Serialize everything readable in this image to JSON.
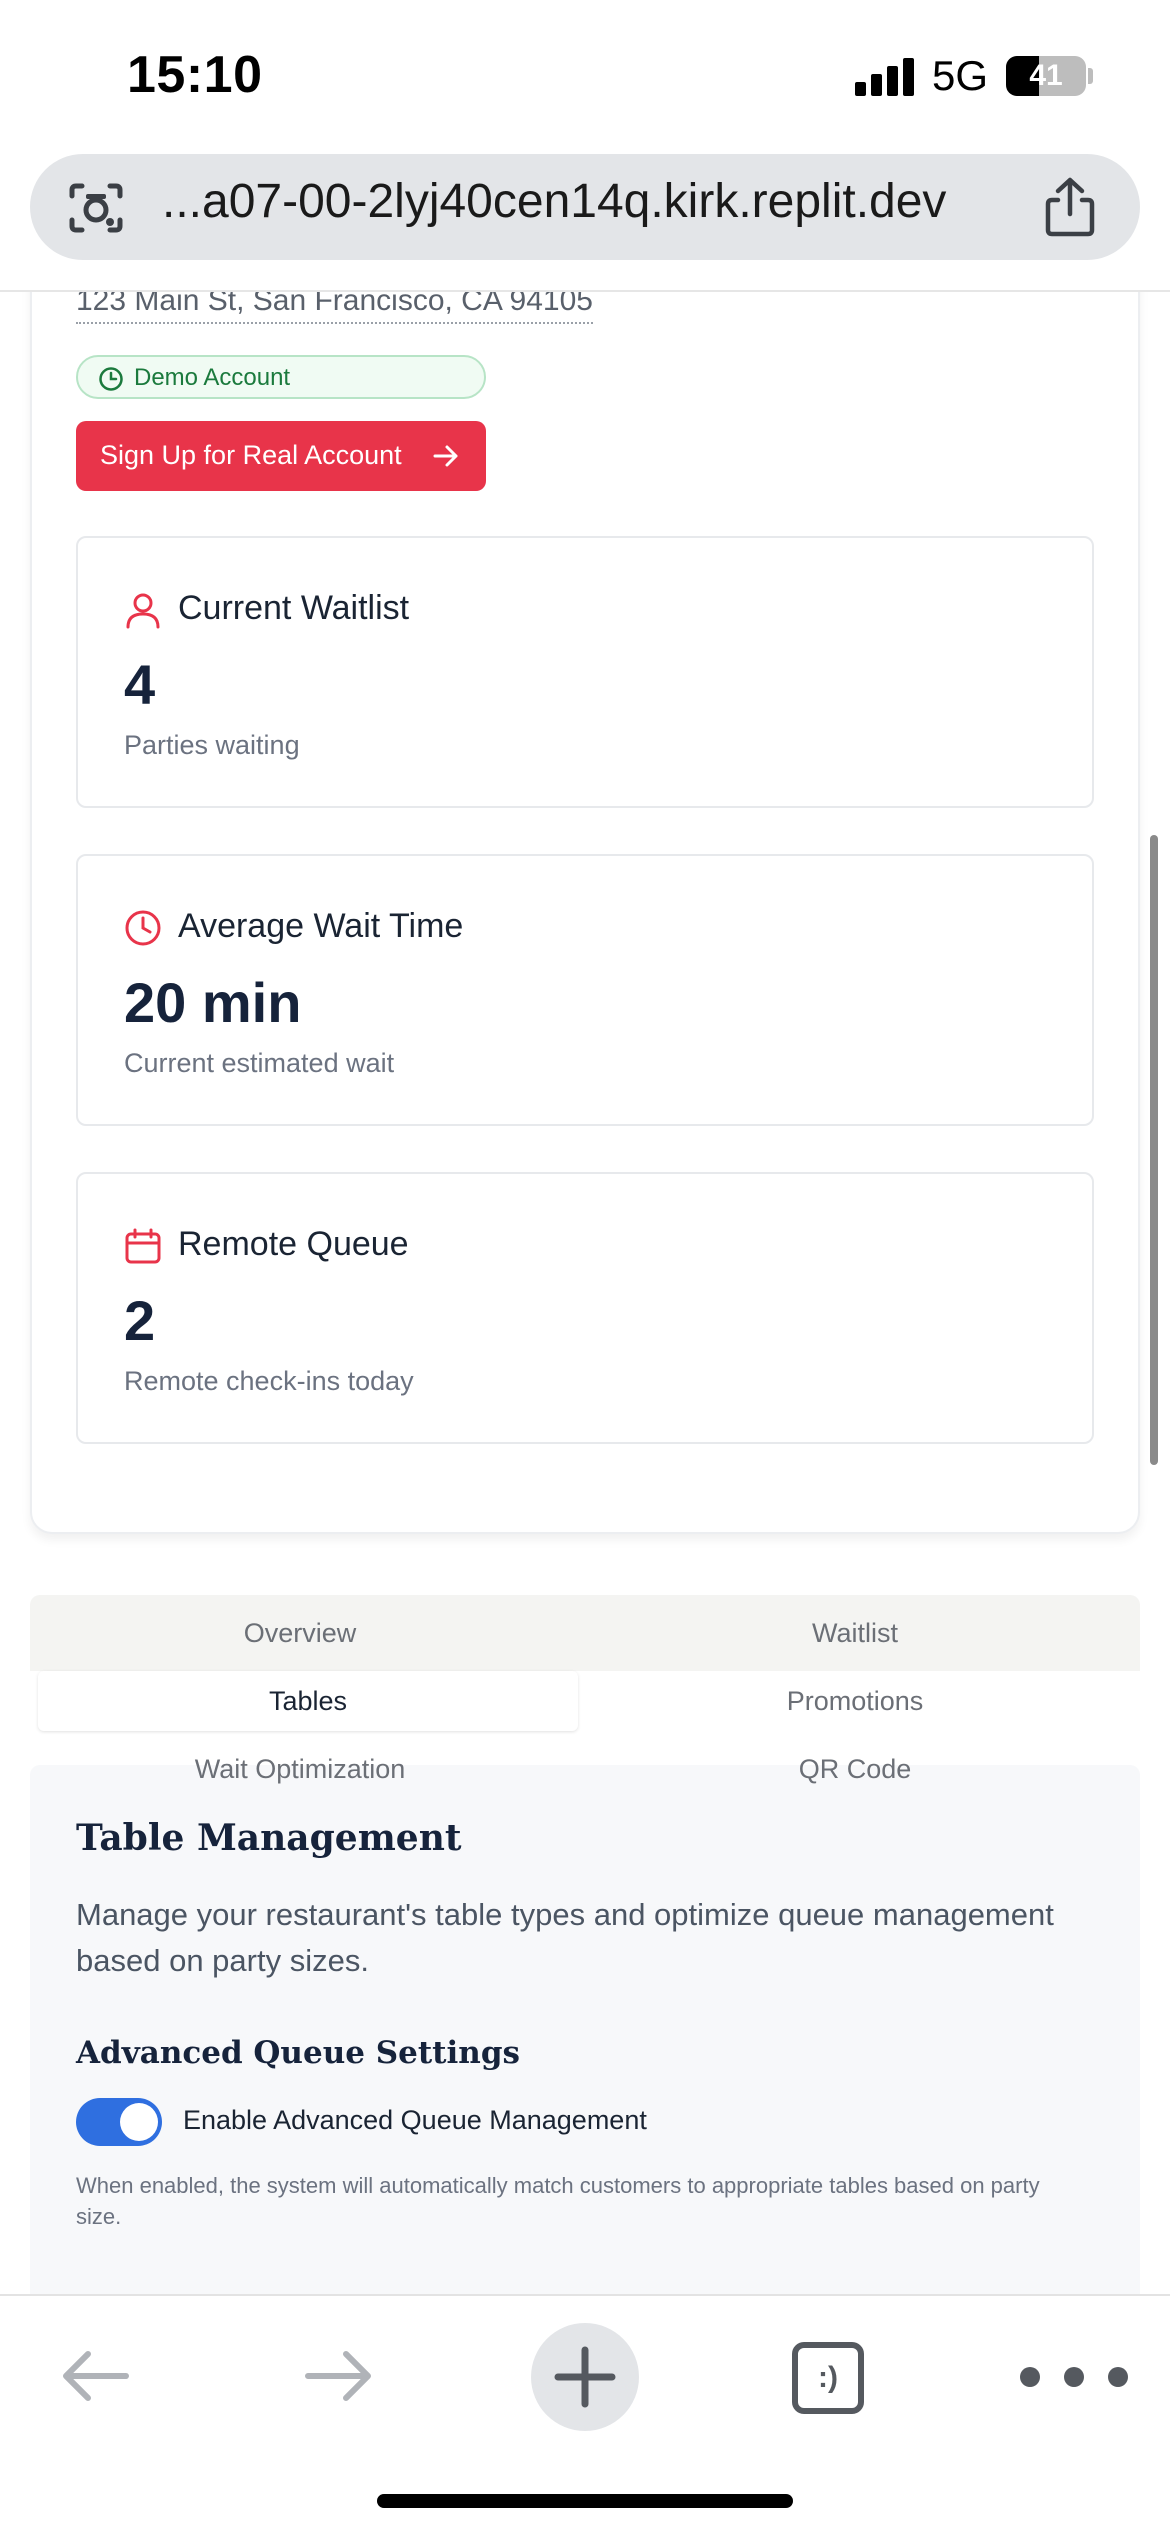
{
  "status_bar": {
    "time": "15:10",
    "network": "5G",
    "battery_percent": "41",
    "battery_level": 0.41
  },
  "browser": {
    "url": "...a07-00-2lyj40cen14q.kirk.replit.dev"
  },
  "restaurant": {
    "address": "123 Main St, San Francisco, CA 94105",
    "demo_badge": "Demo Account",
    "signup_button": "Sign Up for Real Account"
  },
  "stats": [
    {
      "title": "Current Waitlist",
      "value": "4",
      "subtitle": "Parties waiting",
      "icon": "user-icon"
    },
    {
      "title": "Average Wait Time",
      "value": "20 min",
      "subtitle": "Current estimated wait",
      "icon": "clock-icon"
    },
    {
      "title": "Remote Queue",
      "value": "2",
      "subtitle": "Remote check-ins today",
      "icon": "calendar-icon"
    }
  ],
  "tabs": [
    {
      "label": "Overview",
      "active": false
    },
    {
      "label": "Waitlist",
      "active": false
    },
    {
      "label": "Tables",
      "active": true
    },
    {
      "label": "Promotions",
      "active": false
    },
    {
      "label": "Wait Optimization",
      "active": false
    },
    {
      "label": "QR Code",
      "active": false
    }
  ],
  "table_management": {
    "title": "Table Management",
    "description": "Manage your restaurant's table types and optimize queue management based on party sizes.",
    "advanced_title": "Advanced Queue Settings",
    "toggle_label": "Enable Advanced Queue Management",
    "toggle_on": true,
    "help_text": "When enabled, the system will automatically match customers to appropriate tables based on party size."
  },
  "toolbar": {
    "tabs_icon_text": ":)"
  },
  "colors": {
    "accent_red": "#e8344a",
    "toggle_blue": "#2f6fe0",
    "badge_green": "#1b7a3d"
  }
}
